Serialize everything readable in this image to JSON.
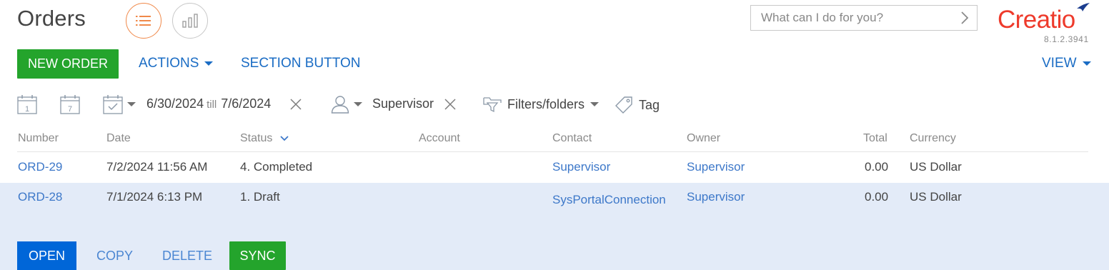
{
  "header": {
    "title": "Orders",
    "search_placeholder": "What can I do for you?",
    "logo_text": "Creatio",
    "version": "8.1.2.3941"
  },
  "toolbar": {
    "new_order_label": "NEW ORDER",
    "actions_label": "ACTIONS",
    "section_button_label": "SECTION BUTTON",
    "view_label": "VIEW"
  },
  "filters": {
    "day_icon_number": "1",
    "week_icon_number": "7",
    "date_from": "6/30/2024",
    "till_label": "till",
    "date_to": "7/6/2024",
    "owner_value": "Supervisor",
    "filters_folders_label": "Filters/folders",
    "tag_label": "Tag"
  },
  "table": {
    "columns": [
      "Number",
      "Date",
      "Status",
      "Account",
      "Contact",
      "Owner",
      "Total",
      "Currency"
    ],
    "rows": [
      {
        "number": "ORD-29",
        "date": "7/2/2024 11:56 AM",
        "status": "4. Completed",
        "account": "",
        "contact": "Supervisor",
        "owner": "Supervisor",
        "total": "0.00",
        "currency": "US Dollar"
      },
      {
        "number": "ORD-28",
        "date": "7/1/2024 6:13 PM",
        "status": "1. Draft",
        "account": "",
        "contact": "SysPortalConnection",
        "owner": "Supervisor",
        "total": "0.00",
        "currency": "US Dollar"
      }
    ],
    "row_actions": {
      "open": "OPEN",
      "copy": "COPY",
      "delete": "DELETE",
      "sync": "SYNC"
    }
  },
  "colors": {
    "accent_orange": "#f0894a",
    "brand_red": "#ee3a2b",
    "green": "#24a42c",
    "link_blue": "#1a6cc4",
    "primary_blue": "#0066d8",
    "selected_row_bg": "#e3ebf8"
  },
  "icons": [
    "list-view-icon",
    "chart-view-icon",
    "chevron-right-icon",
    "calendar-day-icon",
    "calendar-week-icon",
    "calendar-period-icon",
    "close-icon",
    "user-icon",
    "filter-folder-icon",
    "tag-icon",
    "sort-desc-icon"
  ]
}
